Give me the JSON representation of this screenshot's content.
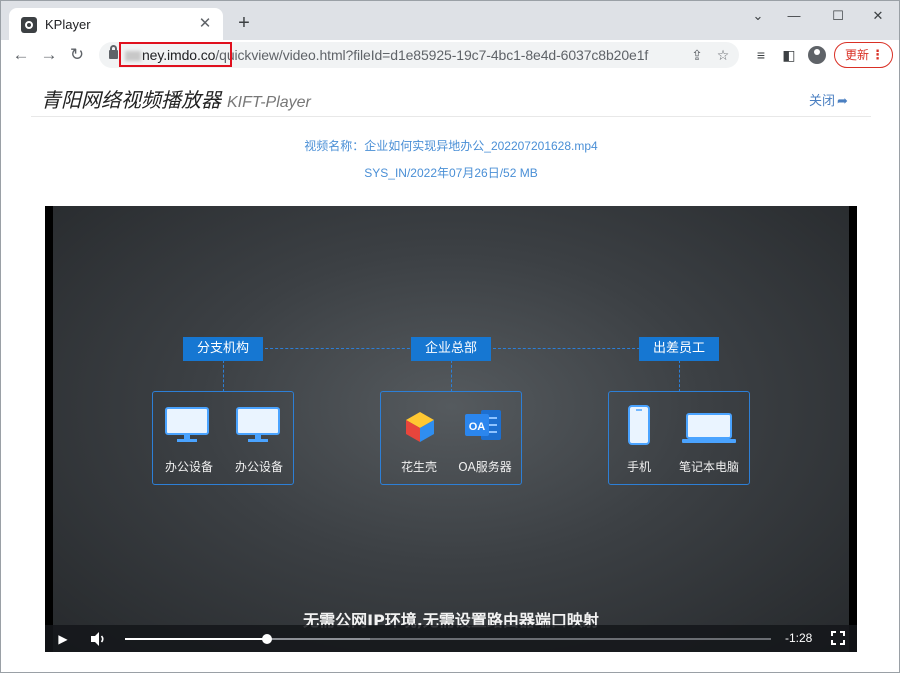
{
  "browser": {
    "tab_title": "KPlayer",
    "new_tab_symbol": "+",
    "close_tab_symbol": "✕",
    "window_controls": [
      "⌄",
      "—",
      "☐",
      "✕"
    ],
    "url": {
      "host_visible": "ney.imdo.co",
      "path": "/quickview/video.html?fileId=d1e85925-19c7-4bc1-8e4d-6037c8b20e1f"
    },
    "update_label": "更新",
    "icons": [
      "back-icon",
      "forward-icon",
      "reload-icon",
      "lock-icon",
      "share-icon",
      "star-icon",
      "media-icon",
      "sidepanel-icon",
      "profile-icon",
      "menu-icon"
    ]
  },
  "page": {
    "brand_cn": "青阳网络视频播放器",
    "brand_en": "KIFT-Player",
    "close_label": "关闭",
    "video_name": "视频名称：企业如何实现异地办公_202207201628.mp4",
    "video_meta": "SYS_IN/2022年07月26日/52 MB"
  },
  "video": {
    "nodes": [
      {
        "title": "分支机构",
        "devices": [
          "办公设备",
          "办公设备"
        ]
      },
      {
        "title": "企业总部",
        "devices": [
          "花生壳",
          "OA服务器"
        ]
      },
      {
        "title": "出差员工",
        "devices": [
          "手机",
          "笔记本电脑"
        ]
      }
    ],
    "oa_icon_text": "OA",
    "subtitle": "无需公网IP环境,无需设置路由器端口映射",
    "time_remaining": "-1:28",
    "progress": 0.22,
    "buffered": 0.38,
    "colors": {
      "accent": "#1677d2",
      "box_border": "#2d7fd6"
    }
  }
}
